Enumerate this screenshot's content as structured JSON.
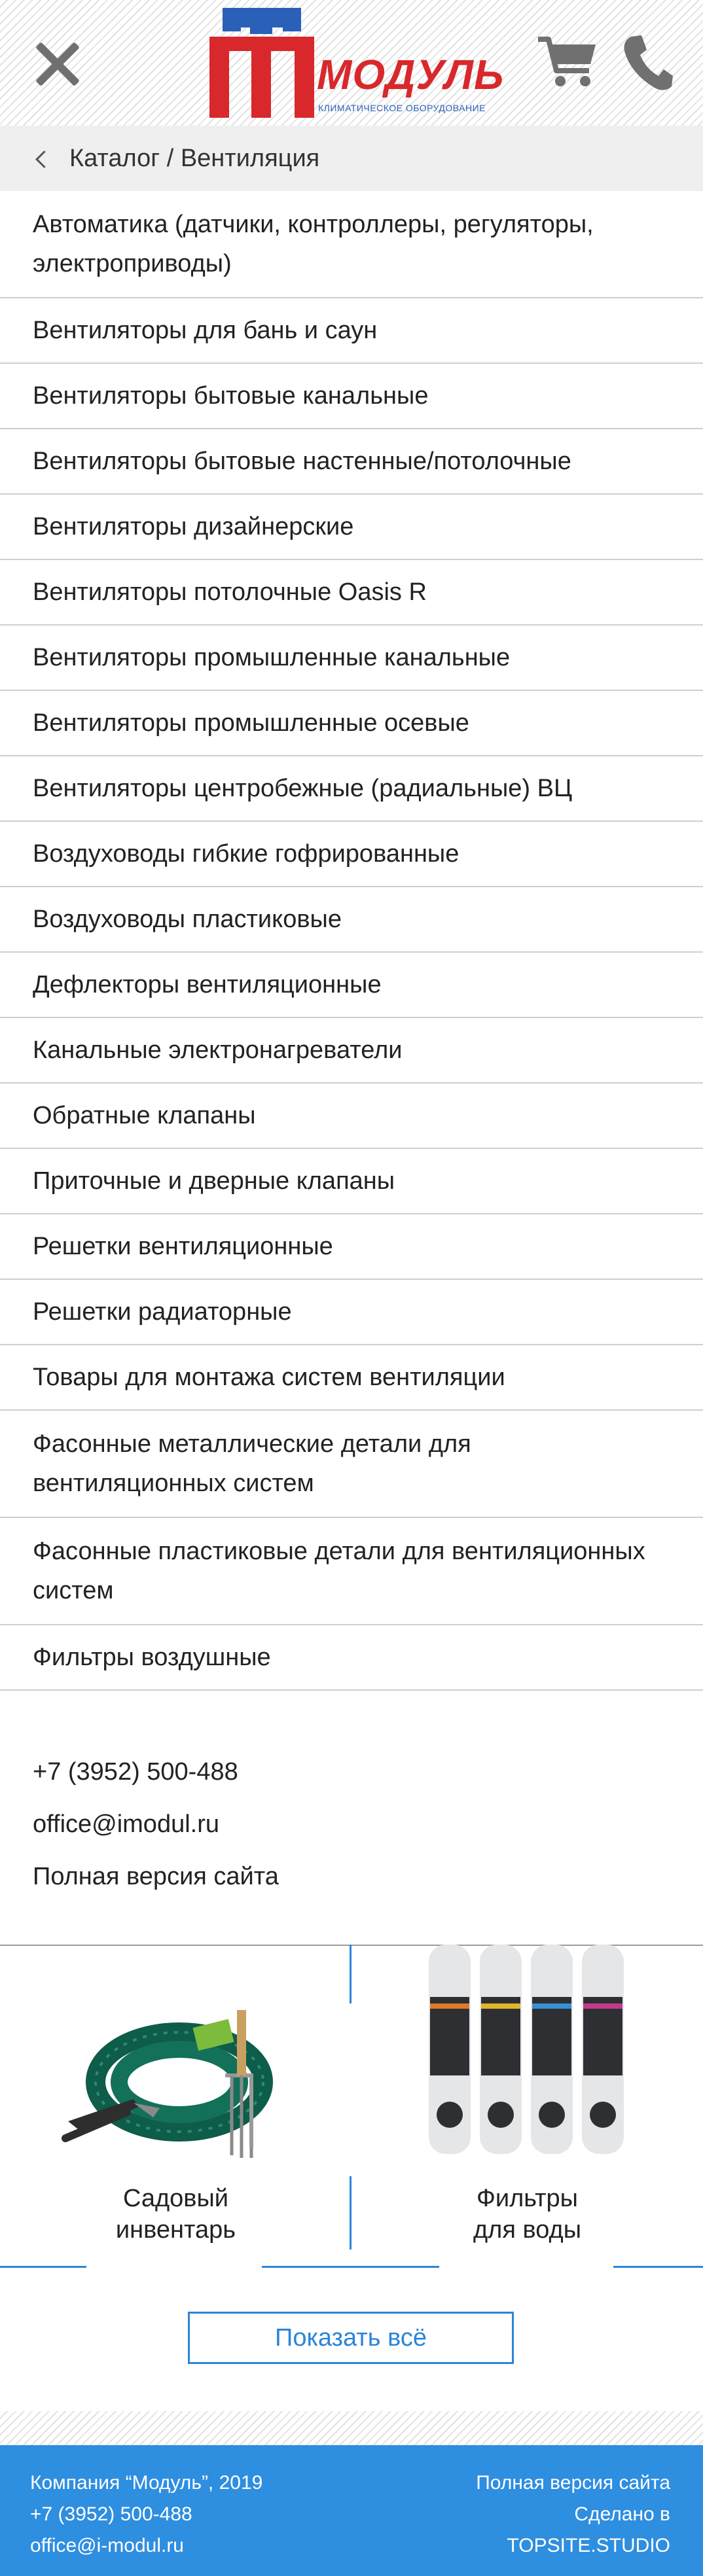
{
  "header": {
    "logo_title": "МОДУЛЬ",
    "logo_subtitle": "КЛИМАТИЧЕСКОЕ ОБОРУДОВАНИЕ",
    "brand_blue": "#2a60b8",
    "brand_red": "#d8282c",
    "icons": [
      "close-icon",
      "cart-icon",
      "phone-icon"
    ]
  },
  "breadcrumb": {
    "root": "Каталог",
    "separator": " / ",
    "current": "Вентиляция"
  },
  "categories": [
    "Автоматика (датчики, контроллеры, регуляторы, электроприводы)",
    "Вентиляторы для бань и саун",
    "Вентиляторы бытовые канальные",
    "Вентиляторы бытовые настенные/потолочные",
    "Вентиляторы дизайнерские",
    "Вентиляторы потолочные Oasis R",
    "Вентиляторы промышленные канальные",
    "Вентиляторы промышленные осевые",
    "Вентиляторы центробежные (радиальные) ВЦ",
    "Воздуховоды гибкие гофрированные",
    "Воздуховоды пластиковые",
    "Дефлекторы вентиляционные",
    "Канальные электронагреватели",
    "Обратные клапаны",
    "Приточные и дверные клапаны",
    "Решетки вентиляционные",
    "Решетки радиаторные",
    "Товары для монтажа систем вентиляции",
    "Фасонные металлические детали для вентиляционных систем",
    "Фасонные пластиковые детали для вентиляционных систем",
    "Фильтры воздушные"
  ],
  "contacts": {
    "phone": "+7 (3952) 500-488",
    "email": "office@imodul.ru",
    "full_version": "Полная версия сайта"
  },
  "promo": [
    {
      "line1": "Садовый",
      "line2": "инвентарь"
    },
    {
      "line1": "Фильтры",
      "line2": "для воды"
    }
  ],
  "show_all": "Показать всё",
  "footer": {
    "company": "Компания “Модуль”, 2019",
    "phone": "+7 (3952) 500-488",
    "email": "office@i-modul.ru",
    "full_version": "Полная версия сайта",
    "made_in": "Сделано в",
    "studio": "TOPSITE.STUDIO",
    "color": "#2e8ee0"
  },
  "accent_color": "#2b85d8"
}
